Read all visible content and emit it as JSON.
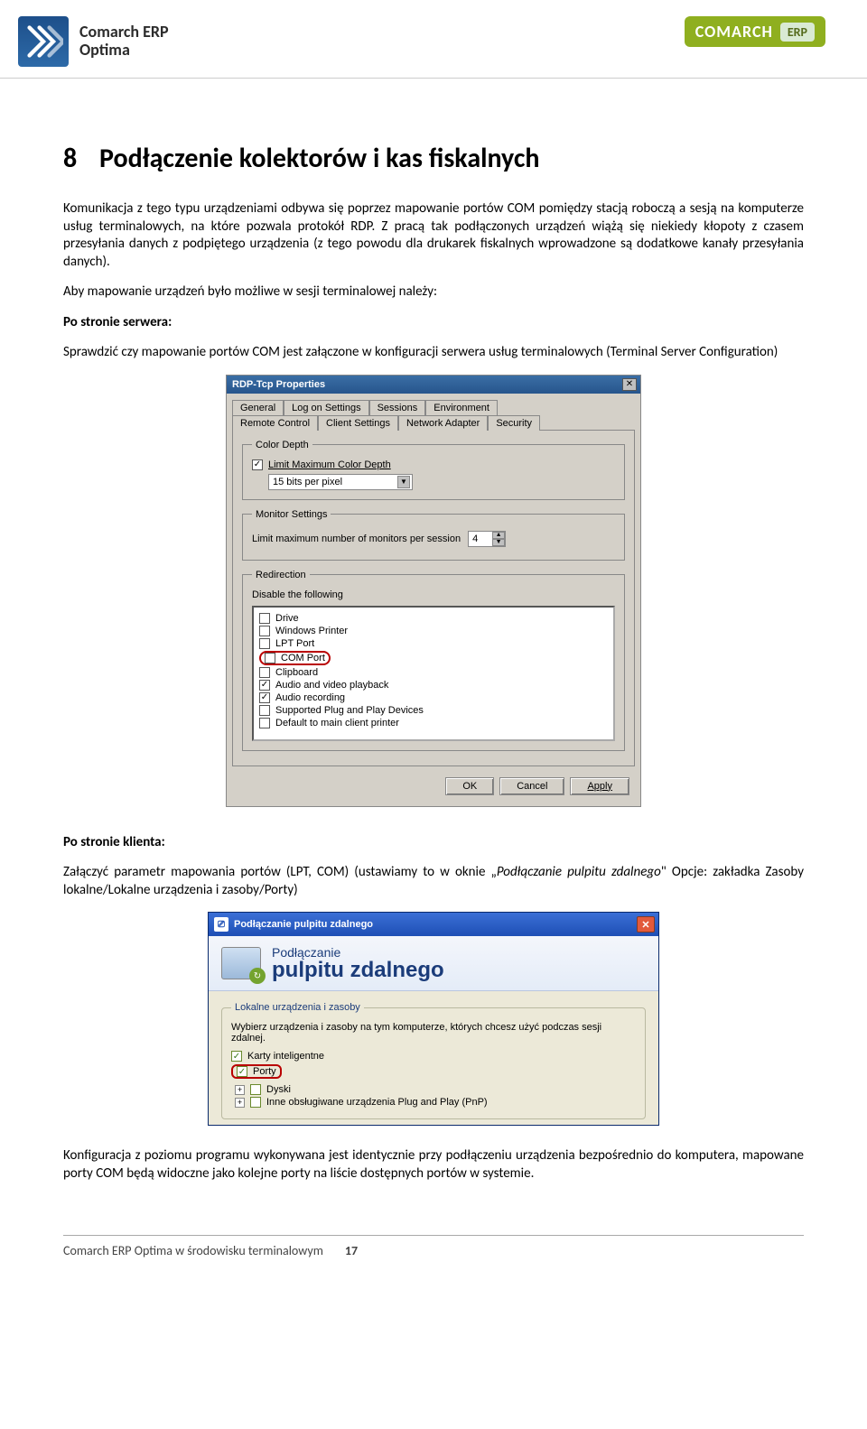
{
  "header": {
    "logo_line1": "Comarch ERP",
    "logo_line2": "Optima",
    "brand": "COMARCH",
    "erp": "ERP"
  },
  "heading": {
    "num": "8",
    "title": "Podłączenie kolektorów i kas fiskalnych"
  },
  "para1": "Komunikacja z tego typu urządzeniami odbywa się poprzez mapowanie portów COM pomiędzy stacją roboczą a sesją na komputerze usług terminalowych, na które pozwala protokół RDP. Z pracą tak podłączonych urządzeń wiążą się niekiedy kłopoty z czasem przesyłania danych z podpiętego urządzenia (z tego powodu dla drukarek fiskalnych wprowadzone są dodatkowe kanały przesyłania danych).",
  "para2": "Aby mapowanie urządzeń było możliwe w sesji terminalowej należy:",
  "server_side_label": "Po stronie serwera:",
  "server_side_text": "Sprawdzić czy mapowanie portów COM jest załączone w konfiguracji serwera usług terminalowych (Terminal Server Configuration)",
  "rdp": {
    "title": "RDP-Tcp Properties",
    "tabs_row1": [
      "General",
      "Log on Settings",
      "Sessions",
      "Environment"
    ],
    "tabs_row2": [
      "Remote Control",
      "Client Settings",
      "Network Adapter",
      "Security"
    ],
    "active_tab": "Client Settings",
    "grp_color": "Color Depth",
    "limit_color_label": "Limit Maximum Color Depth",
    "color_select": "15 bits per pixel",
    "grp_monitor": "Monitor Settings",
    "monitor_label": "Limit maximum number of monitors per session",
    "monitor_value": "4",
    "grp_redir": "Redirection",
    "disable_label": "Disable the following",
    "redir_items": [
      {
        "label": "Drive",
        "checked": false,
        "circled": false
      },
      {
        "label": "Windows Printer",
        "checked": false,
        "circled": false
      },
      {
        "label": "LPT Port",
        "checked": false,
        "circled": false
      },
      {
        "label": "COM Port",
        "checked": false,
        "circled": true
      },
      {
        "label": "Clipboard",
        "checked": false,
        "circled": false
      },
      {
        "label": "Audio and video playback",
        "checked": true,
        "circled": false
      },
      {
        "label": "Audio recording",
        "checked": true,
        "circled": false
      },
      {
        "label": "Supported Plug and Play Devices",
        "checked": false,
        "circled": false
      },
      {
        "label": "Default to main client printer",
        "checked": false,
        "circled": false
      }
    ],
    "btn_ok": "OK",
    "btn_cancel": "Cancel",
    "btn_apply": "Apply"
  },
  "client_side_label": "Po stronie klienta:",
  "client_side_text_a": "Załączyć parametr mapowania portów (LPT, COM) (ustawiamy to w oknie „",
  "client_side_text_italic": "Podłączanie pulpitu zdalnego",
  "client_side_text_b": "\" Opcje: zakładka Zasoby lokalne/Lokalne urządzenia i zasoby/Porty)",
  "xp": {
    "title": "Podłączanie pulpitu zdalnego",
    "banner_l1": "Podłączanie",
    "banner_l2": "pulpitu zdalnego",
    "group": "Lokalne urządzenia i zasoby",
    "desc": "Wybierz urządzenia i zasoby na tym komputerze, których chcesz użyć podczas sesji zdalnej.",
    "chk_smart": "Karty inteligentne",
    "chk_ports": "Porty",
    "tree_disks": "Dyski",
    "tree_pnp": "Inne obsługiwane urządzenia Plug and Play (PnP)"
  },
  "para_bottom": "Konfiguracja z poziomu programu wykonywana jest identycznie przy podłączeniu urządzenia bezpośrednio do komputera, mapowane porty COM będą widoczne jako kolejne porty na liście dostępnych portów w systemie.",
  "footer": {
    "text": "Comarch ERP Optima w środowisku terminalowym",
    "page": "17"
  }
}
